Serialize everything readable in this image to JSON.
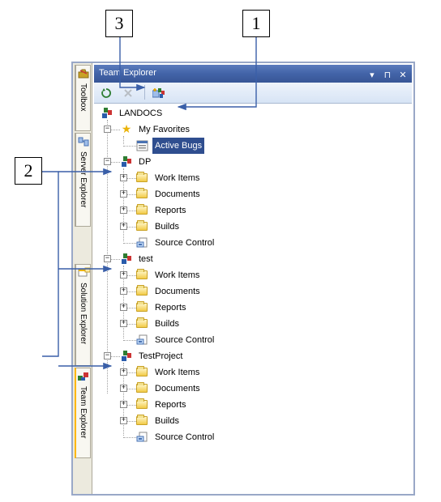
{
  "callouts": {
    "c1": "1",
    "c2": "2",
    "c3": "3"
  },
  "titlebar": {
    "title": "Team Explorer"
  },
  "toolbar": {
    "refresh": "Refresh",
    "stop": "Stop",
    "add_server": "Add Existing Team Project"
  },
  "sidebar": {
    "tabs": [
      {
        "label": "Toolbox"
      },
      {
        "label": "Server Explorer"
      },
      {
        "label": "Solution Explorer"
      },
      {
        "label": "Team Explorer"
      }
    ]
  },
  "tree": {
    "server": "LANDOCS",
    "favorites": "My Favorites",
    "active_bugs": "Active Bugs",
    "projects": [
      {
        "name": "DP"
      },
      {
        "name": "test"
      },
      {
        "name": "TestProject"
      }
    ],
    "child_labels": {
      "work_items": "Work Items",
      "documents": "Documents",
      "reports": "Reports",
      "builds": "Builds",
      "source_control": "Source Control"
    }
  }
}
